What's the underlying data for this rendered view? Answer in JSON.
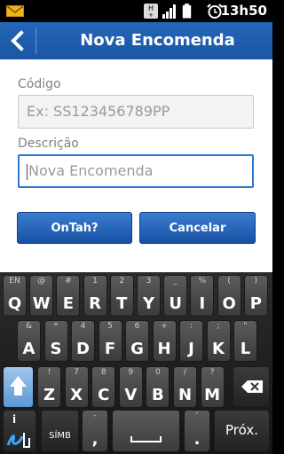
{
  "status": {
    "time": "13h50"
  },
  "header": {
    "title": "Nova Encomenda"
  },
  "form": {
    "code_label": "Código",
    "code_placeholder": "Ex: SS123456789PP",
    "desc_label": "Descrição",
    "desc_placeholder": "Nova Encomenda"
  },
  "buttons": {
    "ontah": "OnTah?",
    "cancel": "Cancelar"
  },
  "keyboard": {
    "row1": [
      {
        "sub": "EN",
        "main": "Q"
      },
      {
        "sub": "@",
        "main": "W"
      },
      {
        "sub": "#",
        "main": "E"
      },
      {
        "sub": "1",
        "main": "R"
      },
      {
        "sub": "2",
        "main": "T"
      },
      {
        "sub": "3",
        "main": "Y"
      },
      {
        "sub": "_",
        "main": "U"
      },
      {
        "sub": "%",
        "main": "I"
      },
      {
        "sub": "(",
        "main": "O"
      },
      {
        "sub": ")",
        "main": "P"
      }
    ],
    "row2": [
      {
        "sub": "&",
        "main": "A"
      },
      {
        "sub": "*",
        "main": "S"
      },
      {
        "sub": "4",
        "main": "D"
      },
      {
        "sub": "5",
        "main": "F"
      },
      {
        "sub": "6",
        "main": "G"
      },
      {
        "sub": "+",
        "main": "H"
      },
      {
        "sub": ":",
        "main": "J"
      },
      {
        "sub": ";",
        "main": "K"
      },
      {
        "sub": "\"",
        "main": "L"
      }
    ],
    "row3": [
      {
        "sub": "!",
        "main": "Z"
      },
      {
        "sub": "7",
        "main": "X"
      },
      {
        "sub": "8",
        "main": "C"
      },
      {
        "sub": "9",
        "main": "V"
      },
      {
        "sub": "0",
        "main": "B"
      },
      {
        "sub": "/",
        "main": "N"
      },
      {
        "sub": "?",
        "main": "M"
      }
    ],
    "sym_label": "SÍMB",
    "comma_main": ",",
    "comma_sub": "-",
    "period_main": ".",
    "period_sub": "'",
    "info_label": "i",
    "next_label": "Próx."
  },
  "colors": {
    "header": "#1f5fb0",
    "accent": "#2a79d6"
  }
}
